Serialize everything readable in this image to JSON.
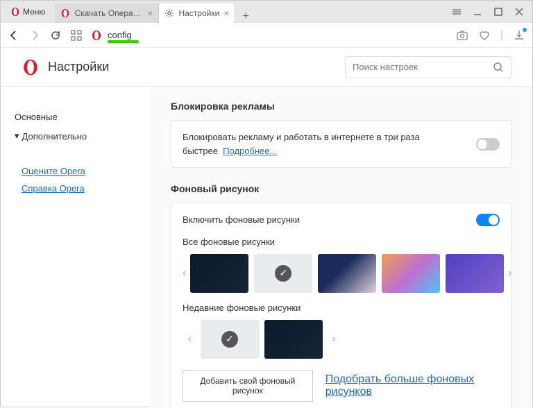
{
  "menu": {
    "label": "Меню"
  },
  "tabs": [
    {
      "label": "Скачать Опера для компь",
      "active": false
    },
    {
      "label": "Настройки",
      "active": true
    }
  ],
  "address": {
    "text": "config"
  },
  "header": {
    "title": "Настройки"
  },
  "search": {
    "placeholder": "Поиск настроек"
  },
  "sidebar": {
    "main": "Основные",
    "advanced": "Дополнительно",
    "links": {
      "rate": "Оцените Opera",
      "help": "Справка Opera"
    }
  },
  "sections": {
    "adblock": {
      "title": "Блокировка рекламы",
      "text": "Блокировать рекламу и работать в интернете в три раза быстрее",
      "learn_more": "Подробнее..."
    },
    "wallpaper": {
      "title": "Фоновый рисунок",
      "enable": "Включить фоновые рисунки",
      "all_label": "Все фоновые рисунки",
      "recent_label": "Недавние фоновые рисунки",
      "add_btn": "Добавить свой фоновый рисунок",
      "more_link": "Подобрать больше фоновых рисунков"
    }
  }
}
